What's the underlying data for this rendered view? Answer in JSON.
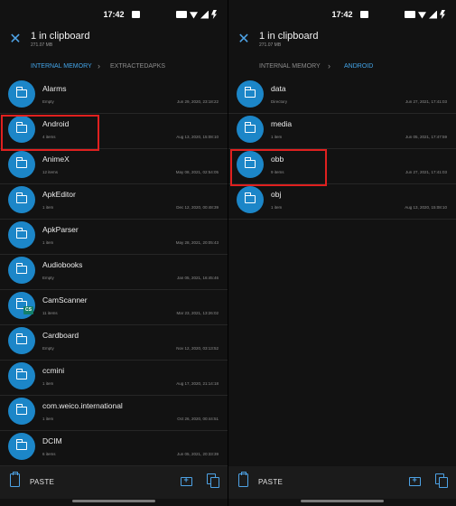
{
  "left": {
    "status": {
      "time": "17:42"
    },
    "clipboard": {
      "title": "1 in clipboard",
      "size": "271.07 MB"
    },
    "breadcrumb": {
      "first": "INTERNAL MEMORY",
      "second": "EXTRACTEDAPKS"
    },
    "items": [
      {
        "name": "Alarms",
        "sub": "Empty",
        "date": "Jun 29, 2020, 23:18:22"
      },
      {
        "name": "Android",
        "sub": "4 items",
        "date": "Aug 13, 2020, 15:08:10"
      },
      {
        "name": "AnimeX",
        "sub": "12 items",
        "date": "May 08, 2021, 02:54:05"
      },
      {
        "name": "ApkEditor",
        "sub": "1 item",
        "date": "Dec 12, 2020, 00:48:39"
      },
      {
        "name": "ApkParser",
        "sub": "1 item",
        "date": "May 28, 2021, 20:05:43"
      },
      {
        "name": "Audiobooks",
        "sub": "Empty",
        "date": "Jan 05, 2021, 16:45:46"
      },
      {
        "name": "CamScanner",
        "sub": "11 items",
        "date": "Mar 23, 2021, 13:26:02",
        "badge": "CS"
      },
      {
        "name": "Cardboard",
        "sub": "Empty",
        "date": "Nov 12, 2020, 03:13:52"
      },
      {
        "name": "ccmini",
        "sub": "1 item",
        "date": "Aug 17, 2020, 21:14:18"
      },
      {
        "name": "com.weico.international",
        "sub": "1 item",
        "date": "Oct 26, 2020, 00:44:51"
      },
      {
        "name": "DCIM",
        "sub": "6 items",
        "date": "Jun 05, 2021, 20:33:39"
      }
    ],
    "bottom": {
      "paste": "PASTE"
    }
  },
  "right": {
    "status": {
      "time": "17:42"
    },
    "clipboard": {
      "title": "1 in clipboard",
      "size": "271.07 MB"
    },
    "breadcrumb": {
      "first": "INTERNAL MEMORY",
      "second": "ANDROID"
    },
    "items": [
      {
        "name": "data",
        "sub": "Directory",
        "date": "Jun 27, 2021, 17:41:03"
      },
      {
        "name": "media",
        "sub": "1 item",
        "date": "Jun 05, 2021, 17:47:59"
      },
      {
        "name": "obb",
        "sub": "9 items",
        "date": "Jun 27, 2021, 17:41:03"
      },
      {
        "name": "obj",
        "sub": "1 item",
        "date": "Aug 13, 2020, 15:08:10"
      }
    ],
    "bottom": {
      "paste": "PASTE"
    }
  },
  "colors": {
    "accent": "#43a4e8",
    "folder": "#1c86c8",
    "highlight": "#e0201f"
  },
  "icons": [
    "close-icon",
    "folder-icon",
    "paste-icon",
    "new-folder-icon",
    "copy-icon"
  ]
}
